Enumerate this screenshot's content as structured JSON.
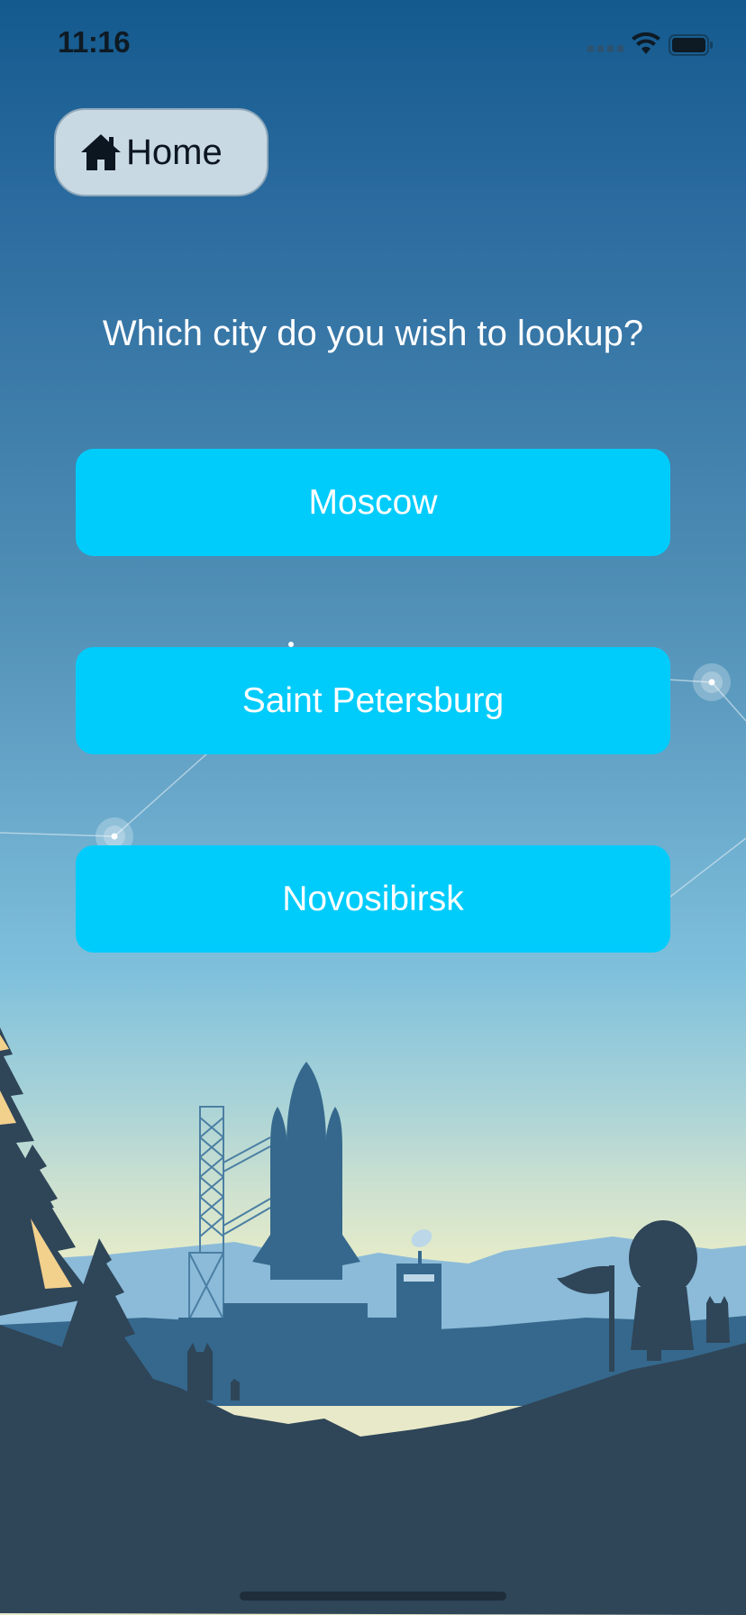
{
  "status_bar": {
    "time": "11:16",
    "wifi_icon": "wifi-icon",
    "battery_icon": "battery-icon"
  },
  "nav": {
    "home_label": "Home",
    "home_icon": "house-icon"
  },
  "prompt": {
    "question": "Which city do you wish to lookup?"
  },
  "cities": {
    "items": [
      {
        "label": "Moscow"
      },
      {
        "label": "Saint Petersburg"
      },
      {
        "label": "Novosibirsk"
      }
    ]
  },
  "colors": {
    "city_button": "#00ccfb",
    "home_button": "#c8d9e4",
    "landscape_dark": "#2f4558",
    "landscape_mid": "#35688c"
  }
}
